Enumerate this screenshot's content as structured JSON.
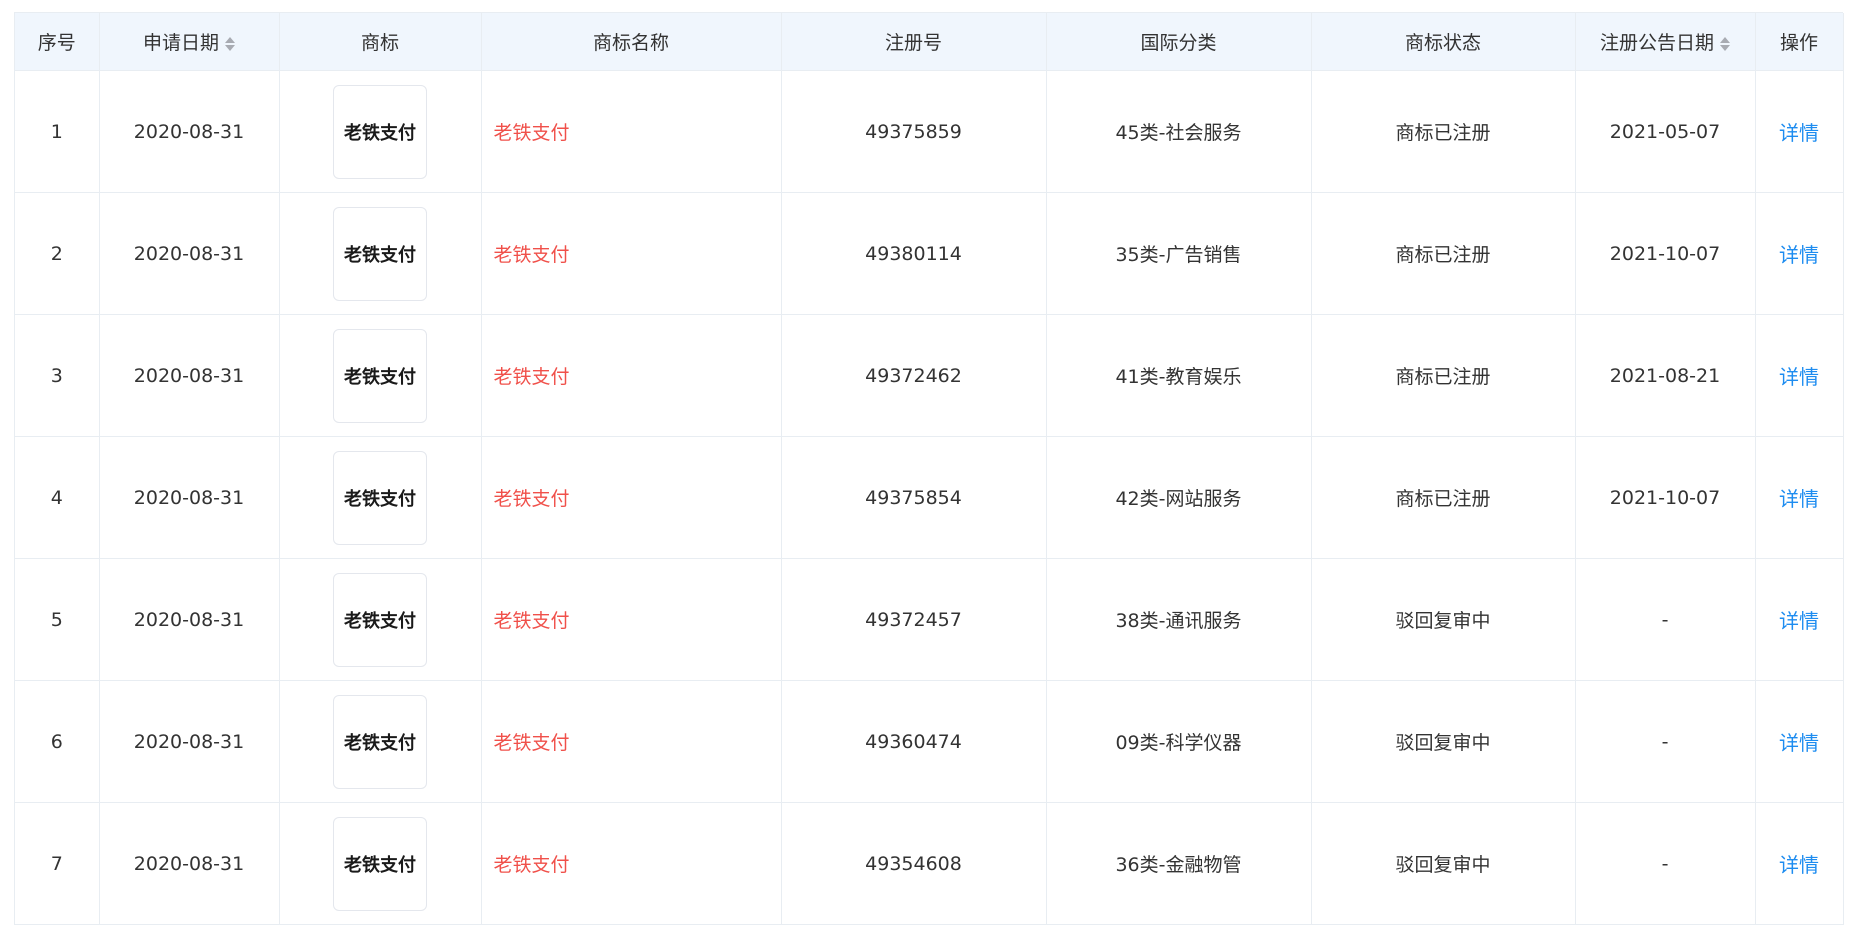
{
  "table": {
    "headers": {
      "index": "序号",
      "apply_date": "申请日期",
      "logo": "商标",
      "name": "商标名称",
      "reg_no": "注册号",
      "class": "国际分类",
      "status": "商标状态",
      "notice_date": "注册公告日期",
      "action": "操作"
    },
    "rows": [
      {
        "index": "1",
        "apply_date": "2020-08-31",
        "logo_text": "老铁支付",
        "name": "老铁支付",
        "reg_no": "49375859",
        "class": "45类-社会服务",
        "status": "商标已注册",
        "notice_date": "2021-05-07",
        "action": "详情"
      },
      {
        "index": "2",
        "apply_date": "2020-08-31",
        "logo_text": "老铁支付",
        "name": "老铁支付",
        "reg_no": "49380114",
        "class": "35类-广告销售",
        "status": "商标已注册",
        "notice_date": "2021-10-07",
        "action": "详情"
      },
      {
        "index": "3",
        "apply_date": "2020-08-31",
        "logo_text": "老铁支付",
        "name": "老铁支付",
        "reg_no": "49372462",
        "class": "41类-教育娱乐",
        "status": "商标已注册",
        "notice_date": "2021-08-21",
        "action": "详情"
      },
      {
        "index": "4",
        "apply_date": "2020-08-31",
        "logo_text": "老铁支付",
        "name": "老铁支付",
        "reg_no": "49375854",
        "class": "42类-网站服务",
        "status": "商标已注册",
        "notice_date": "2021-10-07",
        "action": "详情"
      },
      {
        "index": "5",
        "apply_date": "2020-08-31",
        "logo_text": "老铁支付",
        "name": "老铁支付",
        "reg_no": "49372457",
        "class": "38类-通讯服务",
        "status": "驳回复审中",
        "notice_date": "-",
        "action": "详情"
      },
      {
        "index": "6",
        "apply_date": "2020-08-31",
        "logo_text": "老铁支付",
        "name": "老铁支付",
        "reg_no": "49360474",
        "class": "09类-科学仪器",
        "status": "驳回复审中",
        "notice_date": "-",
        "action": "详情"
      },
      {
        "index": "7",
        "apply_date": "2020-08-31",
        "logo_text": "老铁支付",
        "name": "老铁支付",
        "reg_no": "49354608",
        "class": "36类-金融物管",
        "status": "驳回复审中",
        "notice_date": "-",
        "action": "详情"
      }
    ]
  },
  "colors": {
    "header_bg": "#f0f6fd",
    "border": "#e8edf2",
    "name_text": "#f0504a",
    "link": "#1d8cf0"
  },
  "icons": {
    "sort": "sort-caret-icon"
  }
}
